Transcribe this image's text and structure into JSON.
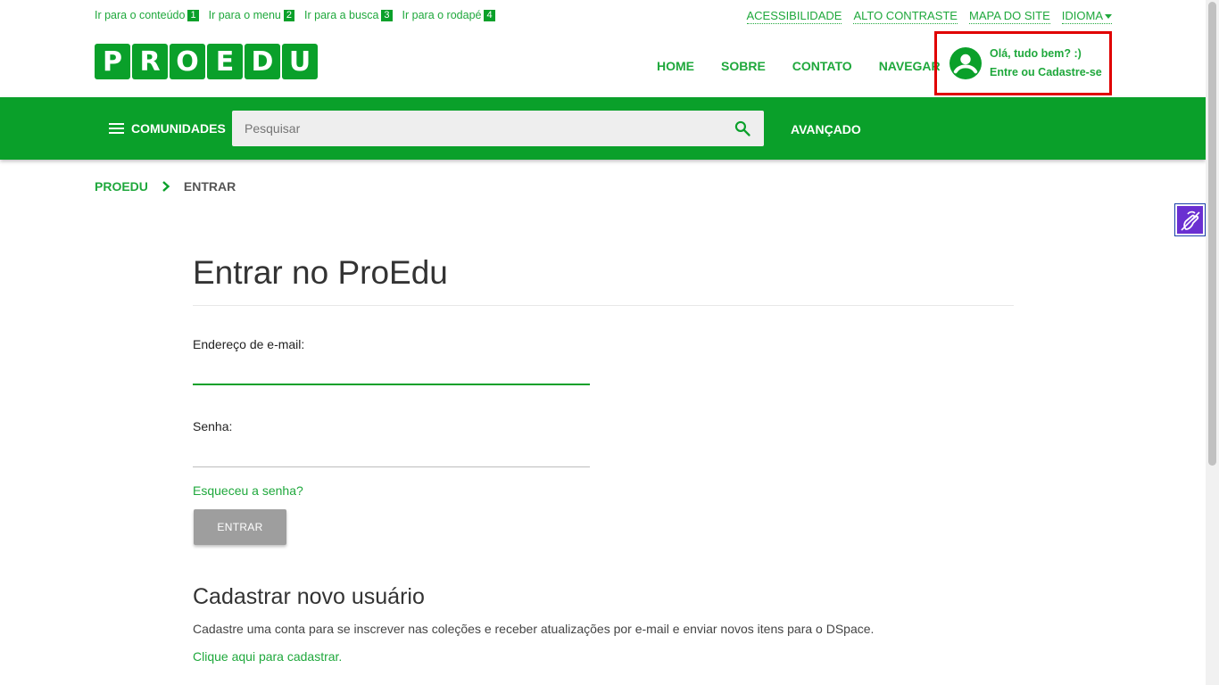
{
  "skip_links": [
    {
      "label": "Ir para o conteúdo",
      "key": "1"
    },
    {
      "label": "Ir para o menu",
      "key": "2"
    },
    {
      "label": "Ir para a busca",
      "key": "3"
    },
    {
      "label": "Ir para o rodapé",
      "key": "4"
    }
  ],
  "utility_links": {
    "accessibility": "ACESSIBILIDADE",
    "high_contrast": "ALTO CONTRASTE",
    "site_map": "MAPA DO SITE",
    "language": "IDIOMA"
  },
  "logo": {
    "letters": [
      "P",
      "R",
      "O",
      "E",
      "D",
      "U"
    ],
    "brand_color": "#0aa02a"
  },
  "main_nav": {
    "home": "HOME",
    "about": "SOBRE",
    "contact": "CONTATO",
    "browse": "NAVEGAR"
  },
  "user_box": {
    "greeting": "Olá, tudo bem? :)",
    "action": "Entre ou Cadastre-se",
    "highlight_color": "#e00000"
  },
  "toolbar": {
    "communities": "COMUNIDADES",
    "search_placeholder": "Pesquisar",
    "advanced": "AVANÇADO"
  },
  "breadcrumb": {
    "home": "PROEDU",
    "current": "ENTRAR"
  },
  "login": {
    "title": "Entrar no ProEdu",
    "email_label": "Endereço de e-mail:",
    "email_value": "",
    "password_label": "Senha:",
    "password_value": "",
    "forgot": "Esqueceu a senha?",
    "submit": "ENTRAR"
  },
  "register": {
    "title": "Cadastrar novo usuário",
    "description": "Cadastre uma conta para se inscrever nas coleções e receber atualizações por e-mail e enviar novos itens para o DSpace.",
    "link": "Clique aqui para cadastrar."
  },
  "icons": {
    "account": "account-circle-icon",
    "search": "search-icon",
    "menu": "hamburger-icon",
    "breadcrumb_separator": "chevron-right-icon",
    "vlibras": "hand-sign-language-icon"
  }
}
